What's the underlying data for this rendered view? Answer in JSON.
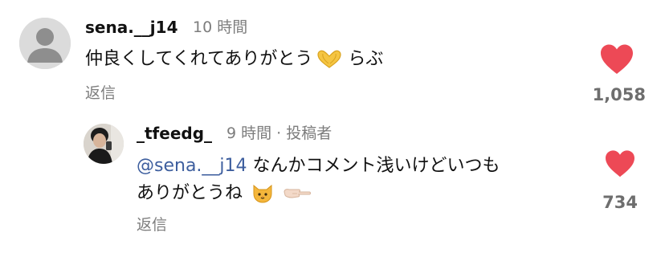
{
  "comment": {
    "username": "sena.__j14",
    "time": "10 時間",
    "text": "仲良くしてくれてありがとう",
    "text_suffix": "らぶ",
    "reply_label": "返信",
    "like_count": "1,058",
    "emoji": "heart-hands"
  },
  "reply": {
    "username": "_tfeedg_",
    "time": "9 時間 · 投稿者",
    "mention": "@sena.__j14",
    "text_line1": " なんかコメント浅いけどいつも",
    "text_line2": "ありがとうね",
    "reply_label": "返信",
    "like_count": "734",
    "emojis": [
      "cat-face",
      "pointing-hand"
    ]
  },
  "colors": {
    "heart": "#ed4956",
    "mention": "#3d5e9e",
    "secondary_text": "#7d7d7d"
  }
}
